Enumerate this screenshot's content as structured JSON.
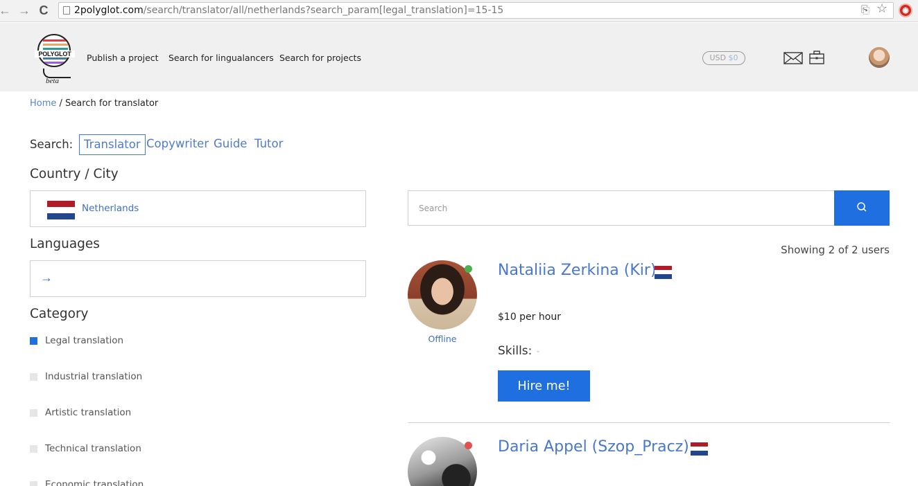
{
  "browser": {
    "url_host": "2polyglot.com",
    "url_path": "/search/translator/all/netherlands?search_param[legal_translation]=15-15",
    "back_glyph": "←",
    "forward_glyph": "→",
    "reload_glyph": "C",
    "translate_glyph": "⎘",
    "star_glyph": "☆",
    "ext_glyph": "◉"
  },
  "header": {
    "logo_text": "POLYGLOT",
    "logo_beta": "beta",
    "nav": [
      "Publish a project",
      "Search for lingualancers",
      "Search for projects"
    ],
    "balance_currency": "USD",
    "balance_amount": "$0"
  },
  "breadcrumb": {
    "home": "Home",
    "separator": " / ",
    "current": "Search for translator"
  },
  "search_types": {
    "label": "Search:",
    "tabs": [
      "Translator",
      "Copywriter",
      "Guide",
      "Tutor"
    ],
    "active": "Translator"
  },
  "filters": {
    "country_title": "Country / City",
    "country_value": "Netherlands",
    "languages_title": "Languages",
    "languages_arrow": "→",
    "category_title": "Category",
    "categories": [
      {
        "label": "Legal translation",
        "checked": true
      },
      {
        "label": "Industrial translation",
        "checked": false
      },
      {
        "label": "Artistic translation",
        "checked": false
      },
      {
        "label": "Technical translation",
        "checked": false
      },
      {
        "label": "Economic translation",
        "checked": false
      }
    ]
  },
  "results": {
    "search_placeholder": "Search",
    "showing": "Showing 2 of 2 users",
    "users": [
      {
        "name": "Nataliia Zerkina (Kir)",
        "status": "Offline",
        "rate": "$10 per hour",
        "skills_label": "Skills:",
        "skills_chevron": "⌄",
        "hire": "Hire me!",
        "online_dot_color": "#4caf50"
      },
      {
        "name": "Daria Appel (Szop_Pracz)",
        "online_dot_color": "#e05050"
      }
    ]
  },
  "colors": {
    "accent": "#1f6fe0",
    "link": "#4a78c9",
    "header_bg": "#f0f0f0",
    "flag_red": "#ae1c28",
    "flag_white": "#ffffff",
    "flag_blue": "#21468b"
  }
}
